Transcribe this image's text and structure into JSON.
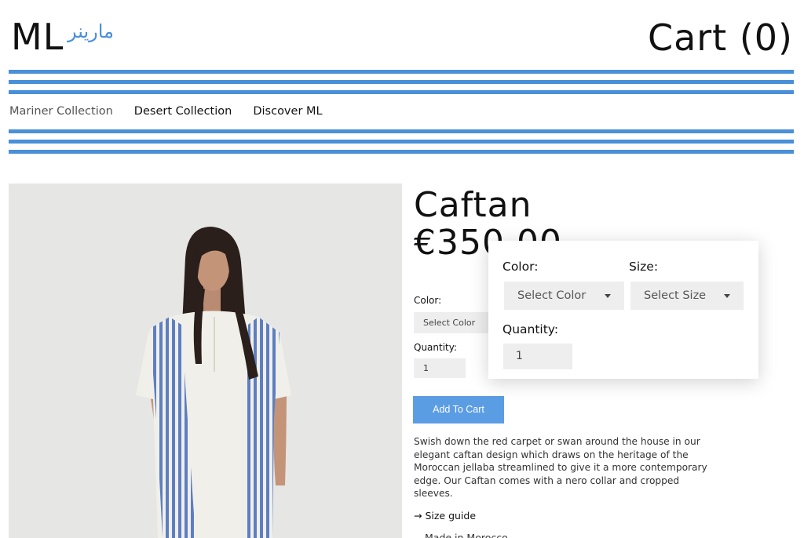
{
  "header": {
    "logo_text": "ML",
    "logo_script": "مارينر",
    "cart_label": "Cart (0)"
  },
  "nav": {
    "items": [
      {
        "label": "Mariner Collection"
      },
      {
        "label": "Desert Collection"
      },
      {
        "label": "Discover ML"
      }
    ]
  },
  "product": {
    "title": "Caftan",
    "price": "€350.00",
    "color_label": "Color:",
    "color_value": "Select Color",
    "quantity_label": "Quantity:",
    "quantity_value": "1",
    "add_to_cart": "Add To Cart",
    "description": "Swish down the red carpet or swan around the house in our elegant caftan design which draws on the heritage of the Moroccan jellaba streamlined to give it a more contemporary edge. Our Caftan comes with a nero collar and cropped sleeves.",
    "size_guide": "→ Size guide",
    "made_in": "Made in Morocco"
  },
  "popup": {
    "color_label": "Color:",
    "color_value": "Select Color",
    "size_label": "Size:",
    "size_value": "Select Size",
    "quantity_label": "Quantity:",
    "quantity_value": "1"
  },
  "colors": {
    "accent": "#4a90d9",
    "button": "#5b9de3",
    "field_bg": "#eeeeee"
  }
}
